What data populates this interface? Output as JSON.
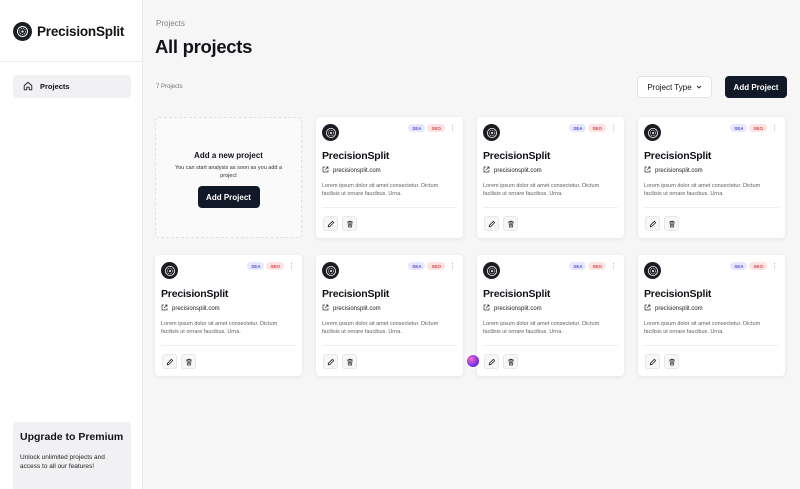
{
  "sidebar": {
    "brand": "PrecisionSplit",
    "nav": [
      {
        "label": "Projects",
        "icon": "home-icon"
      }
    ],
    "upgrade": {
      "title": "Upgrade to Premium",
      "text": "Unlock unlimited projects and access to all our features!"
    }
  },
  "header": {
    "breadcrumb": "Projects",
    "title": "All projects",
    "count": "7 Projects",
    "type_dropdown": "Project Type",
    "add_button": "Add Project"
  },
  "add_card": {
    "title": "Add a new project",
    "subtitle": "You can start analysis as soon as you add a project",
    "button": "Add Project"
  },
  "projects": [
    {
      "name": "PrecisionSplit",
      "url": "precisionsplit.com",
      "tags": [
        "SEA",
        "SEO"
      ],
      "description": "Lorem ipsum dolor sit amet consectetur. Dictum facilisis ut ornare faucibus. Urna."
    },
    {
      "name": "PrecisionSplit",
      "url": "precisionsplit.com",
      "tags": [
        "SEA",
        "SEO"
      ],
      "description": "Lorem ipsum dolor sit amet consectetur. Dictum facilisis ut ornare faucibus. Urna."
    },
    {
      "name": "PrecisionSplit",
      "url": "precisionsplit.com",
      "tags": [
        "SEA",
        "SEO"
      ],
      "description": "Lorem ipsum dolor sit amet consectetur. Dictum facilisis ut ornare faucibus. Urna."
    },
    {
      "name": "PrecisionSplit",
      "url": "precisionsplit.com",
      "tags": [
        "SEA",
        "SEO"
      ],
      "description": "Lorem ipsum dolor sit amet consectetur. Dictum facilisis ut ornare faucibus. Urna."
    },
    {
      "name": "PrecisionSplit",
      "url": "precisionsplit.com",
      "tags": [
        "SEA",
        "SEO"
      ],
      "description": "Lorem ipsum dolor sit amet consectetur. Dictum facilisis ut ornare faucibus. Urna."
    },
    {
      "name": "PrecisionSplit",
      "url": "precisionsplit.com",
      "tags": [
        "SEA",
        "SEO"
      ],
      "description": "Lorem ipsum dolor sit amet consectetur. Dictum facilisis ut ornare faucibus. Urna."
    },
    {
      "name": "PrecisionSplit",
      "url": "precisionsplit.com",
      "tags": [
        "SEA",
        "SEO"
      ],
      "description": "Lorem ipsum dolor sit amet consectetur. Dictum facilisis ut ornare faucibus. Urna."
    }
  ],
  "colors": {
    "primary_button": "#111827",
    "sea_tag_bg": "#e7e7fd",
    "sea_tag_text": "#5b52d6",
    "seo_tag_bg": "#fde3e3",
    "seo_tag_text": "#d44848",
    "background": "#f6f6f7"
  }
}
